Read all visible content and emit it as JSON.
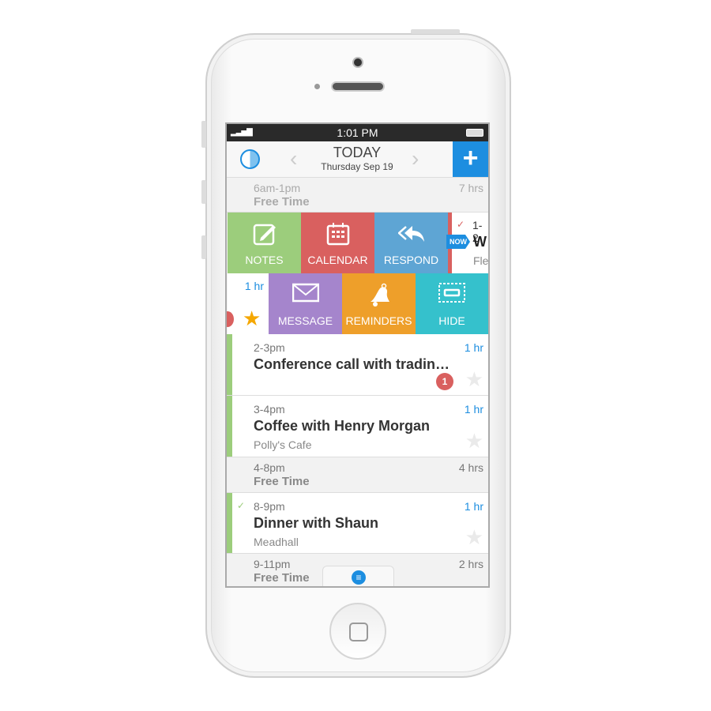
{
  "status": {
    "time": "1:01 PM"
  },
  "header": {
    "title": "TODAY",
    "date": "Thursday Sep 19",
    "add_label": "+"
  },
  "actions": {
    "notes": "NOTES",
    "calendar": "CALENDAR",
    "respond": "RESPOND",
    "message": "MESSAGE",
    "reminders": "REMINDERS",
    "hide": "HIDE"
  },
  "partial_event": {
    "time": "1-2",
    "title": "W",
    "location": "Fle",
    "now_badge": "NOW",
    "duration": "1 hr"
  },
  "events": [
    {
      "time": "6am-1pm",
      "title": "Free Time",
      "duration": "7 hrs"
    },
    {
      "time": "2-3pm",
      "title": "Conference call with tradin…",
      "duration": "1 hr",
      "badge": "1"
    },
    {
      "time": "3-4pm",
      "title": "Coffee with Henry Morgan",
      "location": "Polly's Cafe",
      "duration": "1 hr"
    },
    {
      "time": "4-8pm",
      "title": "Free Time",
      "duration": "4 hrs"
    },
    {
      "time": "8-9pm",
      "title": "Dinner with Shaun",
      "location": "Meadhall",
      "duration": "1 hr",
      "check": "✓"
    },
    {
      "time": "9-11pm",
      "title": "Free Time",
      "duration": "2 hrs"
    }
  ],
  "colors": {
    "notes": "#9ccd7c",
    "calendar": "#d9605f",
    "respond": "#5ea5d4",
    "message": "#a585cc",
    "reminders": "#ee9f2a",
    "hide": "#35c1cc",
    "accent": "#1d8ee0"
  }
}
